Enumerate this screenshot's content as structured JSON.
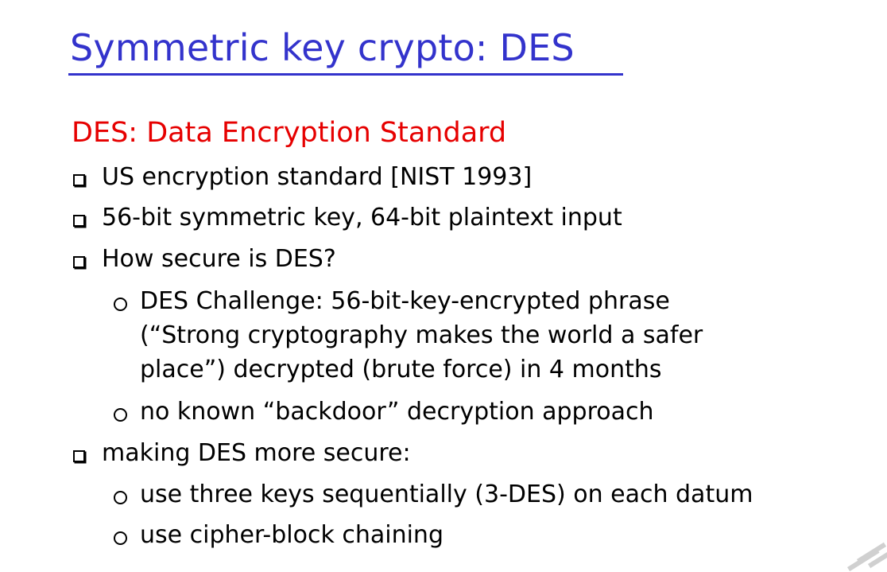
{
  "slide": {
    "title": "Symmetric key crypto: DES",
    "subtitle": "DES: Data Encryption Standard",
    "lines": [
      "US encryption standard [NIST 1993]",
      "56-bit symmetric key, 64-bit plaintext input",
      "How secure is DES?",
      "DES Challenge: 56-bit-key-encrypted phrase",
      "(“Strong cryptography makes the world a safer",
      "place”) decrypted (brute force) in 4 months",
      "no known “backdoor” decryption approach",
      "making DES more secure:",
      "use three keys sequentially (3-DES) on each datum",
      "use cipher-block chaining"
    ]
  },
  "colors": {
    "title": "#3333cc",
    "subtitle": "#e60000",
    "text": "#000000",
    "background": "#ffffff"
  },
  "icons": {
    "level1_bullet": "square-bullet-icon",
    "level2_bullet": "circle-bullet-icon",
    "corner": "corner-decoration-icon"
  }
}
